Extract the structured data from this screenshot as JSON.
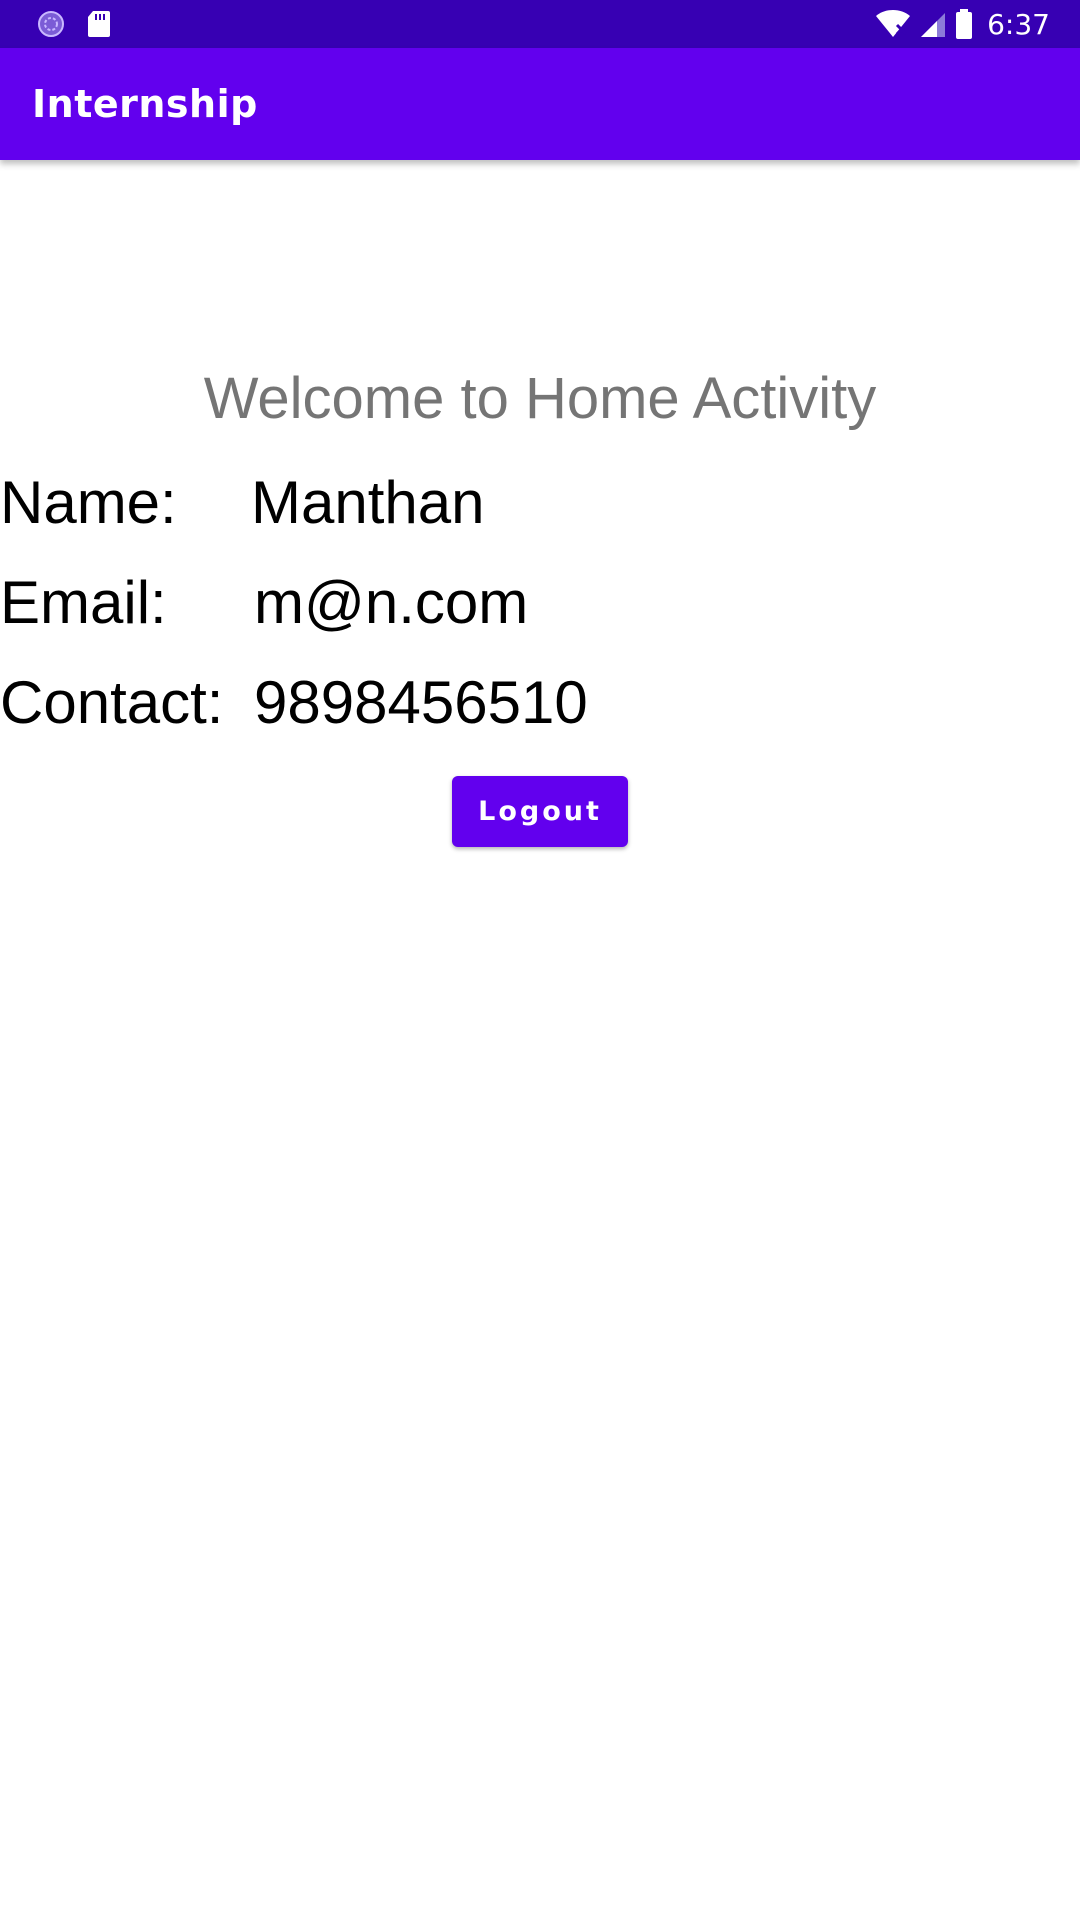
{
  "status_bar": {
    "time": "6:37",
    "left_icons": [
      "sync-icon",
      "sd-card-icon"
    ],
    "right_icons": [
      "wifi-off-icon",
      "signal-icon",
      "battery-icon"
    ],
    "background": "#3700B3"
  },
  "app_bar": {
    "title": "Internship",
    "background": "#6200EE"
  },
  "main": {
    "welcome_text": "Welcome to Home Activity",
    "fields": [
      {
        "label": "Name:",
        "value": "Manthan"
      },
      {
        "label": "Email:",
        "value": "m@n.com"
      },
      {
        "label": "Contact:",
        "value": "9898456510"
      }
    ],
    "logout_label": "Logout",
    "accent_color": "#6200EE"
  }
}
